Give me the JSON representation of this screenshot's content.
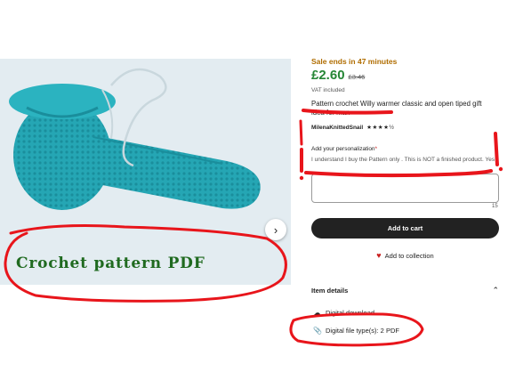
{
  "product_image": {
    "next_arrow_glyph": "›",
    "overlay_text": "Crochet pattern PDF"
  },
  "listing": {
    "sale_text": "Sale ends in 47 minutes",
    "price": "£2.60",
    "old_price": "£3.46",
    "vat_text": "VAT included",
    "title": "Pattern crochet Willy warmer classic and open tiped gift idea for man",
    "shop_name": "MilenaKnittedSnail",
    "rating_stars": "★★★★½"
  },
  "personalization": {
    "label": "Add your personalization",
    "required_mark": "*",
    "instructions": "I understand I buy the Pattern only . This is NOT a finished product. Yes",
    "char_count": "15"
  },
  "actions": {
    "add_to_cart": "Add to cart",
    "add_to_collection": "Add to collection",
    "heart_glyph": "♥"
  },
  "item_details": {
    "title": "Item details",
    "chevron_glyph": "⌃",
    "items": [
      {
        "icon": "cloud-download-icon",
        "glyph": "☁",
        "label": "Digital download"
      },
      {
        "icon": "paperclip-icon",
        "glyph": "📎",
        "label": "Digital file type(s): 2 PDF"
      }
    ]
  },
  "colors": {
    "annotation_red": "#e8151b",
    "price_green": "#258635",
    "sale_orange": "#b06d00",
    "yarn_teal": "#25a6b4"
  }
}
